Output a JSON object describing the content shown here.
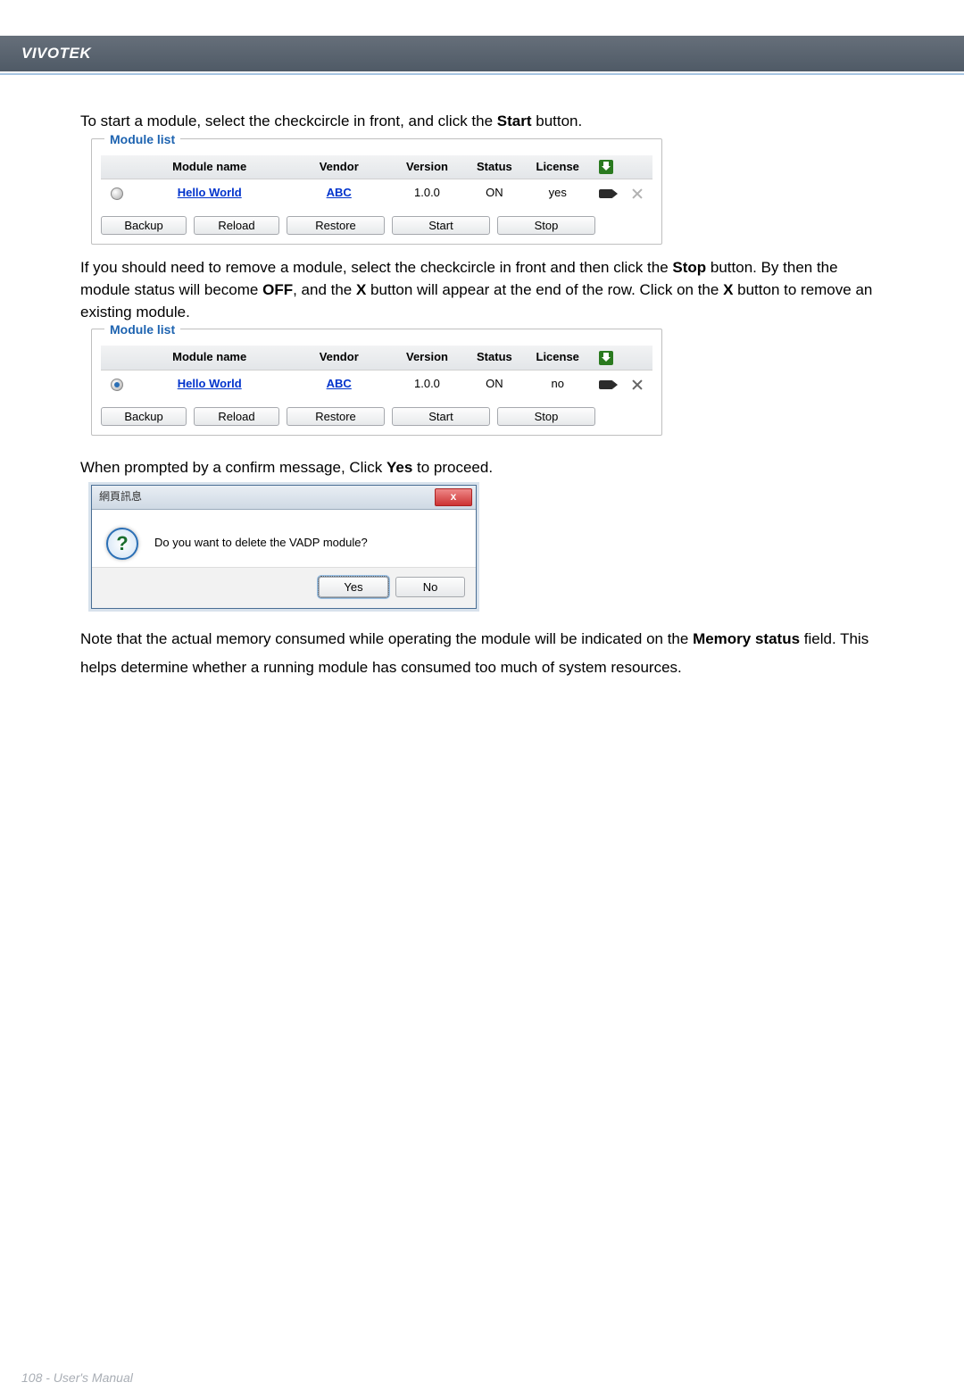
{
  "brand": "VIVOTEK",
  "para1_a": "To start a module, select the checkcircle in front, and click the ",
  "para1_b": "Start",
  "para1_c": " button.",
  "module_list_legend": "Module list",
  "cols": {
    "name": "Module name",
    "vendor": "Vendor",
    "version": "Version",
    "status": "Status",
    "license": "License"
  },
  "list1": {
    "selected": false,
    "name": "Hello World",
    "vendor": "ABC",
    "version": "1.0.0",
    "status": "ON",
    "license": "yes",
    "deletable": false
  },
  "list2": {
    "selected": true,
    "name": "Hello World",
    "vendor": "ABC",
    "version": "1.0.0",
    "status": "ON",
    "license": "no",
    "deletable": true
  },
  "buttons": {
    "backup": "Backup",
    "reload": "Reload",
    "restore": "Restore",
    "start": "Start",
    "stop": "Stop"
  },
  "para2_a": "If you should need to remove a module, select the checkcircle in front and then click the ",
  "para2_b": "Stop",
  "para2_c": " button. By then the module status will become ",
  "para2_d": "OFF",
  "para2_e": ", and the ",
  "para2_f": "X",
  "para2_g": " button will appear at the end of the row. Click on the ",
  "para2_h": "X",
  "para2_i": " button to remove an existing module.",
  "para3_a": "When prompted by a confirm message, Click ",
  "para3_b": "Yes",
  "para3_c": " to proceed.",
  "dialog": {
    "title": "網頁訊息",
    "msg": "Do you want to delete the VADP module?",
    "yes": "Yes",
    "no": "No"
  },
  "para4_a": "Note that the actual memory consumed while operating the module will be indicated on the ",
  "para4_b": "Memory status",
  "para4_c": " field. This helps determine whether a running module has consumed too much of system resources.",
  "footer": "108 - User's Manual"
}
